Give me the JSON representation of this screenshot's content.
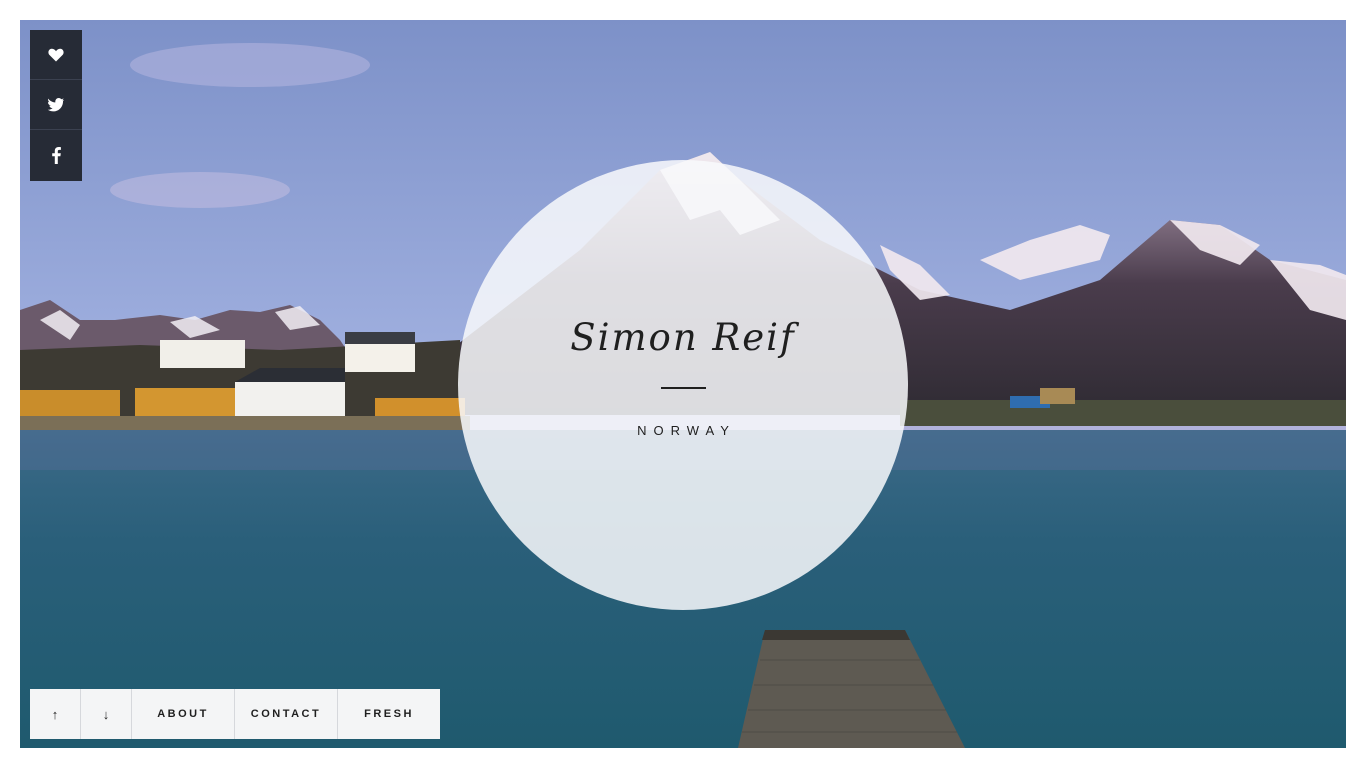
{
  "hero": {
    "title": "Simon Reif",
    "subtitle": "NORWAY"
  },
  "social": [
    {
      "icon": "heart-icon"
    },
    {
      "icon": "twitter-icon"
    },
    {
      "icon": "facebook-icon"
    }
  ],
  "nav": {
    "up": "↑",
    "down": "↓",
    "about": "ABOUT",
    "contact": "CONTACT",
    "fresh": "FRESH"
  },
  "colors": {
    "social_bg": "#262b36",
    "nav_bg": "#f4f5f6",
    "circle_bg": "#f8f9fb",
    "text": "#1f1f1f"
  }
}
